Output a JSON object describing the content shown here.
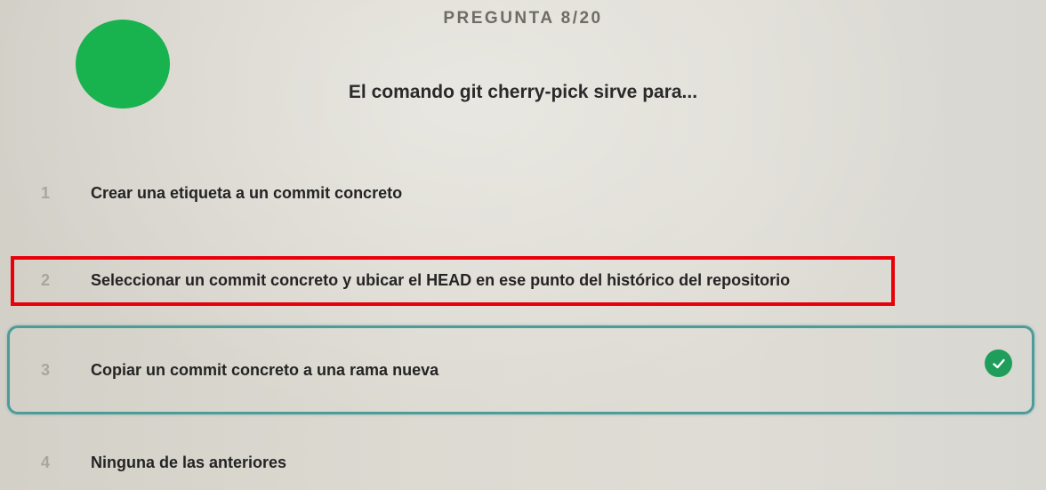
{
  "header": {
    "counter": "PREGUNTA 8/20",
    "avatar_color": "#18b24f"
  },
  "question": {
    "text": "El comando git cherry-pick sirve para..."
  },
  "options": [
    {
      "number": "1",
      "label": "Crear una etiqueta a un commit concreto",
      "state": "normal"
    },
    {
      "number": "2",
      "label": "Seleccionar un commit concreto y ubicar el HEAD en ese punto del histórico del repositorio",
      "state": "highlighted"
    },
    {
      "number": "3",
      "label": "Copiar un commit concreto a una rama nueva",
      "state": "selected-correct"
    },
    {
      "number": "4",
      "label": "Ninguna de las anteriores",
      "state": "normal"
    }
  ],
  "colors": {
    "highlight_border": "#e8000b",
    "selected_border": "#4e9c99",
    "check_badge": "#1f9d5a"
  },
  "icons": {
    "correct": "check-circle-icon"
  }
}
